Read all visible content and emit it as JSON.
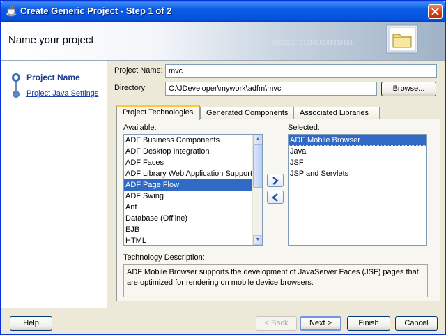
{
  "window": {
    "title": "Create Generic Project - Step 1 of 2"
  },
  "header": {
    "title": "Name your project",
    "bits": "010101010101010101010101"
  },
  "sidebar": {
    "items": [
      {
        "label": "Project Name",
        "active": true
      },
      {
        "label": "Project Java Settings",
        "active": false
      }
    ]
  },
  "form": {
    "project_name_label": "Project Name:",
    "project_name_value": "mvc",
    "directory_label": "Directory:",
    "directory_value": "C:\\JDeveloper\\mywork\\adfm\\mvc",
    "browse_label": "Browse..."
  },
  "tabs": [
    {
      "label": "Project Technologies",
      "active": true
    },
    {
      "label": "Generated Components",
      "active": false
    },
    {
      "label": "Associated Libraries",
      "active": false
    }
  ],
  "available": {
    "label": "Available:",
    "items": [
      "ADF Business Components",
      "ADF Desktop Integration",
      "ADF Faces",
      "ADF Library Web Application Support",
      "ADF Page Flow",
      "ADF Swing",
      "Ant",
      "Database (Offline)",
      "EJB",
      "HTML"
    ],
    "selected_index": 4
  },
  "selected": {
    "label": "Selected:",
    "items": [
      "ADF Mobile Browser",
      "Java",
      "JSF",
      "JSP and Servlets"
    ],
    "selected_index": 0
  },
  "technology_description": {
    "label": "Technology Description:",
    "text": "ADF Mobile Browser supports the development of JavaServer Faces (JSF) pages that are optimized for rendering on mobile device browsers."
  },
  "footer": {
    "help": "Help",
    "back": "< Back",
    "next": "Next >",
    "finish": "Finish",
    "cancel": "Cancel"
  },
  "colors": {
    "titlebar": "#0552dd",
    "selection": "#316ac5",
    "link": "#1a3fa6"
  }
}
